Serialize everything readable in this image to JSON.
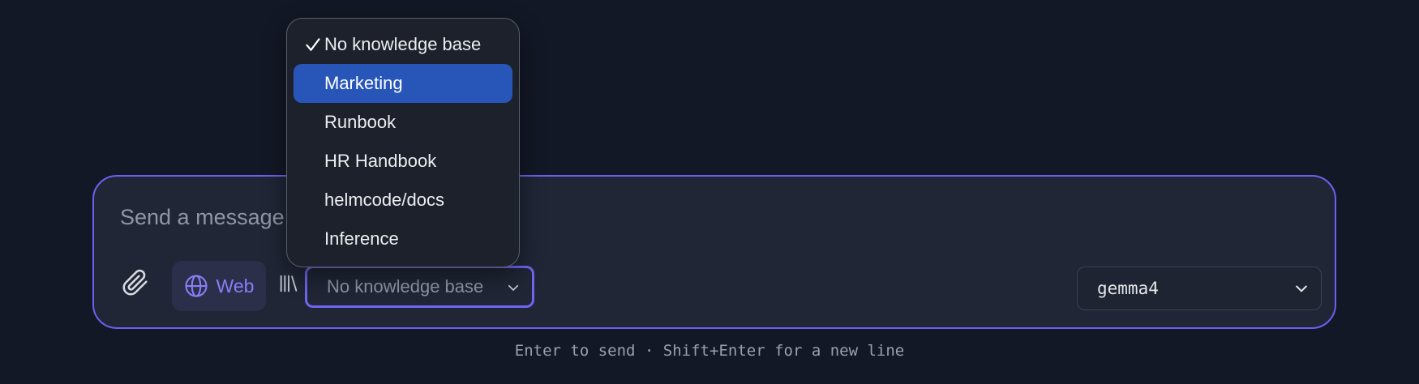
{
  "composer": {
    "placeholder": "Send a message",
    "web_label": "Web",
    "knowledge_base": {
      "selected_label": "No knowledge base",
      "options": [
        {
          "label": "No knowledge base",
          "checked": true
        },
        {
          "label": "Marketing",
          "highlighted": true
        },
        {
          "label": "Runbook"
        },
        {
          "label": "HR Handbook"
        },
        {
          "label": "helmcode/docs"
        },
        {
          "label": "Inference"
        }
      ]
    },
    "model": {
      "selected_label": "gemma4"
    }
  },
  "hint": "Enter to send · Shift+Enter for a new line",
  "icons": {
    "attach": "paperclip-icon",
    "web": "globe-icon",
    "library": "library-icon",
    "chevron": "chevron-down-icon",
    "check": "checkmark-icon"
  },
  "colors": {
    "background": "#131826",
    "composer_bg": "#202636",
    "accent": "#6d5ff0",
    "web_accent": "#8b7cf6",
    "highlight": "#2856b8"
  }
}
